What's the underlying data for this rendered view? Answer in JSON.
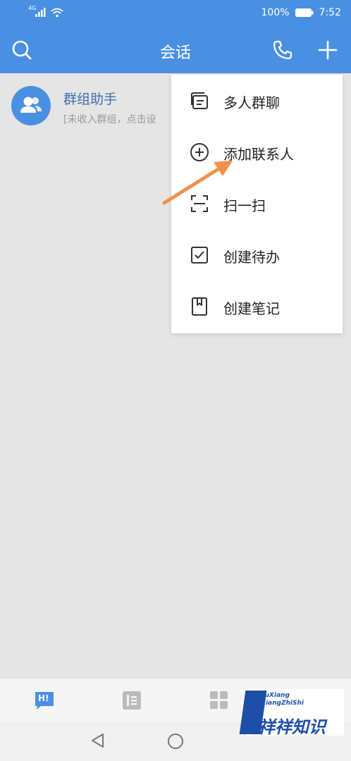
{
  "status_bar": {
    "network": "4G",
    "battery": "100%",
    "time": "7:52"
  },
  "title_bar": {
    "title": "会话"
  },
  "conversation": {
    "name": "群组助手",
    "preview": "[未收入群组，点击设"
  },
  "menu": {
    "items": [
      {
        "label": "多人群聊",
        "icon": "group-chat-icon"
      },
      {
        "label": "添加联系人",
        "icon": "add-circle-icon"
      },
      {
        "label": "扫一扫",
        "icon": "scan-icon"
      },
      {
        "label": "创建待办",
        "icon": "checkbox-icon"
      },
      {
        "label": "创建笔记",
        "icon": "bookmark-note-icon"
      }
    ]
  },
  "tab_bar": {
    "chat_badge": "H!"
  },
  "watermark": {
    "latin_1": "YuXiang",
    "latin_2": "XiangZhiShi",
    "chinese": "誉祥祥知识"
  },
  "colors": {
    "brand_blue": "#4a90e2",
    "arrow_orange": "#f0924a",
    "background": "#e5e5e5"
  }
}
